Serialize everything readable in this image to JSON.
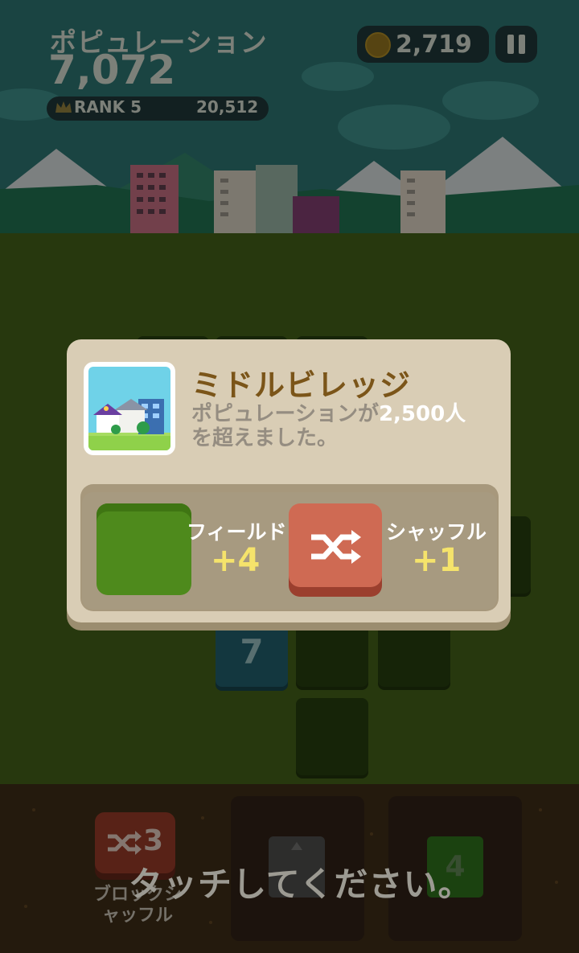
{
  "hud": {
    "population_label": "ポピュレーション",
    "population_value": "7,072",
    "rank_label": "RANK 5",
    "rank_next": "20,512",
    "coins": "2,719"
  },
  "board": {
    "tile_value_7": "7"
  },
  "tray": {
    "shuffle_count": "3",
    "shuffle_label": "ブロックシャッフル",
    "shuffle_label_line1": "ブロックシ",
    "shuffle_label_line2": "ャッフル",
    "next_tile_value": "4",
    "touch_prompt": "タッチしてください。"
  },
  "modal": {
    "title": "ミドルビレッジ",
    "desc_part1": "ポピュレーションが",
    "desc_highlight": "2,500人",
    "desc_part2": "を超えました。",
    "rewards": [
      {
        "label": "フィールド",
        "amount": "+4"
      },
      {
        "label": "シャッフル",
        "amount": "+1"
      }
    ]
  },
  "colors": {
    "modal_bg": "#d9cdb5",
    "title": "#7b5519",
    "reward_amount": "#f5e36b",
    "shuffle_tile": "#cf6a53",
    "field_tile": "#4e8a1c"
  },
  "icons": [
    "crown-icon",
    "coin-icon",
    "pause-icon",
    "shuffle-icon",
    "up-arrow-icon"
  ]
}
